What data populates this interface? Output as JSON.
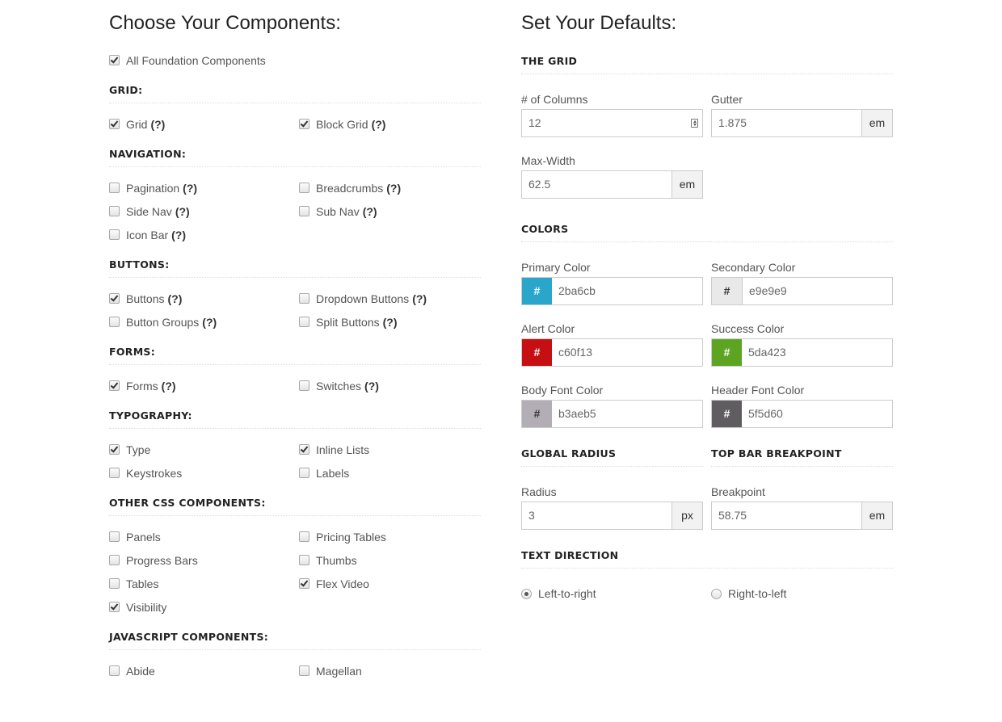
{
  "components": {
    "heading": "Choose Your Components:",
    "all_label": "All Foundation Components",
    "all_checked": true,
    "qmark": "(?)",
    "sections": [
      {
        "title": "GRID:",
        "items": [
          {
            "label": "Grid",
            "checked": true,
            "help": true
          },
          {
            "label": "Block Grid",
            "checked": true,
            "help": true
          }
        ]
      },
      {
        "title": "NAVIGATION:",
        "items": [
          {
            "label": "Pagination",
            "checked": false,
            "help": true
          },
          {
            "label": "Breadcrumbs",
            "checked": false,
            "help": true
          },
          {
            "label": "Side Nav",
            "checked": false,
            "help": true
          },
          {
            "label": "Sub Nav",
            "checked": false,
            "help": true
          },
          {
            "label": "Icon Bar",
            "checked": false,
            "help": true
          }
        ]
      },
      {
        "title": "BUTTONS:",
        "items": [
          {
            "label": "Buttons",
            "checked": true,
            "help": true
          },
          {
            "label": "Dropdown Buttons",
            "checked": false,
            "help": true
          },
          {
            "label": "Button Groups",
            "checked": false,
            "help": true
          },
          {
            "label": "Split Buttons",
            "checked": false,
            "help": true
          }
        ]
      },
      {
        "title": "FORMS:",
        "items": [
          {
            "label": "Forms",
            "checked": true,
            "help": true
          },
          {
            "label": "Switches",
            "checked": false,
            "help": true
          }
        ]
      },
      {
        "title": "TYPOGRAPHY:",
        "items": [
          {
            "label": "Type",
            "checked": true,
            "help": false
          },
          {
            "label": "Inline Lists",
            "checked": true,
            "help": false
          },
          {
            "label": "Keystrokes",
            "checked": false,
            "help": false
          },
          {
            "label": "Labels",
            "checked": false,
            "help": false
          }
        ]
      },
      {
        "title": "OTHER CSS COMPONENTS:",
        "items": [
          {
            "label": "Panels",
            "checked": false,
            "help": false
          },
          {
            "label": "Pricing Tables",
            "checked": false,
            "help": false
          },
          {
            "label": "Progress Bars",
            "checked": false,
            "help": false
          },
          {
            "label": "Thumbs",
            "checked": false,
            "help": false
          },
          {
            "label": "Tables",
            "checked": false,
            "help": false
          },
          {
            "label": "Flex Video",
            "checked": true,
            "help": false
          },
          {
            "label": "Visibility",
            "checked": true,
            "help": false
          }
        ]
      },
      {
        "title": "JAVASCRIPT COMPONENTS:",
        "items": [
          {
            "label": "Abide",
            "checked": false,
            "help": false
          },
          {
            "label": "Magellan",
            "checked": false,
            "help": false
          }
        ]
      }
    ]
  },
  "defaults": {
    "heading": "Set Your Defaults:",
    "grid": {
      "title": "THE GRID",
      "columns_label": "# of Columns",
      "columns_value": "12",
      "gutter_label": "Gutter",
      "gutter_value": "1.875",
      "gutter_unit": "em",
      "maxwidth_label": "Max-Width",
      "maxwidth_value": "62.5",
      "maxwidth_unit": "em"
    },
    "colors": {
      "title": "COLORS",
      "hash": "#",
      "items": [
        {
          "label": "Primary Color",
          "value": "2ba6cb",
          "swatch": "#2ba6cb",
          "hash_color": "#ffffff"
        },
        {
          "label": "Secondary Color",
          "value": "e9e9e9",
          "swatch": "#e9e9e9",
          "hash_color": "#333333"
        },
        {
          "label": "Alert Color",
          "value": "c60f13",
          "swatch": "#c60f13",
          "hash_color": "#ffffff"
        },
        {
          "label": "Success Color",
          "value": "5da423",
          "swatch": "#5da423",
          "hash_color": "#ffffff"
        },
        {
          "label": "Body Font Color",
          "value": "b3aeb5",
          "swatch": "#b3aeb5",
          "hash_color": "#333333"
        },
        {
          "label": "Header Font Color",
          "value": "5f5d60",
          "swatch": "#5f5d60",
          "hash_color": "#ffffff"
        }
      ]
    },
    "radius": {
      "title": "GLOBAL RADIUS",
      "label": "Radius",
      "value": "3",
      "unit": "px"
    },
    "topbar": {
      "title": "TOP BAR BREAKPOINT",
      "label": "Breakpoint",
      "value": "58.75",
      "unit": "em"
    },
    "direction": {
      "title": "TEXT DIRECTION",
      "options": [
        {
          "label": "Left-to-right",
          "selected": true
        },
        {
          "label": "Right-to-left",
          "selected": false
        }
      ]
    }
  }
}
